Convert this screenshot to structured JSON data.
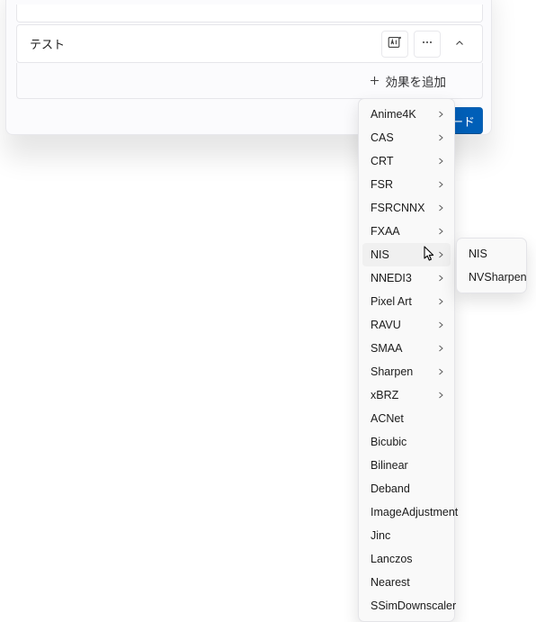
{
  "row": {
    "title": "テスト"
  },
  "add_effect": {
    "label": "効果を追加"
  },
  "blue_button": {
    "label_fragment": "ード"
  },
  "menu": {
    "items": [
      {
        "label": "Anime4K",
        "has_sub": true,
        "hover": false
      },
      {
        "label": "CAS",
        "has_sub": true,
        "hover": false
      },
      {
        "label": "CRT",
        "has_sub": true,
        "hover": false
      },
      {
        "label": "FSR",
        "has_sub": true,
        "hover": false
      },
      {
        "label": "FSRCNNX",
        "has_sub": true,
        "hover": false
      },
      {
        "label": "FXAA",
        "has_sub": true,
        "hover": false
      },
      {
        "label": "NIS",
        "has_sub": true,
        "hover": true
      },
      {
        "label": "NNEDI3",
        "has_sub": true,
        "hover": false
      },
      {
        "label": "Pixel Art",
        "has_sub": true,
        "hover": false
      },
      {
        "label": "RAVU",
        "has_sub": true,
        "hover": false
      },
      {
        "label": "SMAA",
        "has_sub": true,
        "hover": false
      },
      {
        "label": "Sharpen",
        "has_sub": true,
        "hover": false
      },
      {
        "label": "xBRZ",
        "has_sub": true,
        "hover": false
      },
      {
        "label": "ACNet",
        "has_sub": false,
        "hover": false
      },
      {
        "label": "Bicubic",
        "has_sub": false,
        "hover": false
      },
      {
        "label": "Bilinear",
        "has_sub": false,
        "hover": false
      },
      {
        "label": "Deband",
        "has_sub": false,
        "hover": false
      },
      {
        "label": "ImageAdjustment",
        "has_sub": false,
        "hover": false
      },
      {
        "label": "Jinc",
        "has_sub": false,
        "hover": false
      },
      {
        "label": "Lanczos",
        "has_sub": false,
        "hover": false
      },
      {
        "label": "Nearest",
        "has_sub": false,
        "hover": false
      },
      {
        "label": "SSimDownscaler",
        "has_sub": false,
        "hover": false
      }
    ],
    "submenu": [
      {
        "label": "NIS"
      },
      {
        "label": "NVSharpen"
      }
    ]
  },
  "icons": {
    "ai": "ai-icon",
    "more": "more-icon",
    "collapse": "chevron-up-icon",
    "plus": "plus-icon",
    "sub_arrow": "chevron-right-icon"
  }
}
